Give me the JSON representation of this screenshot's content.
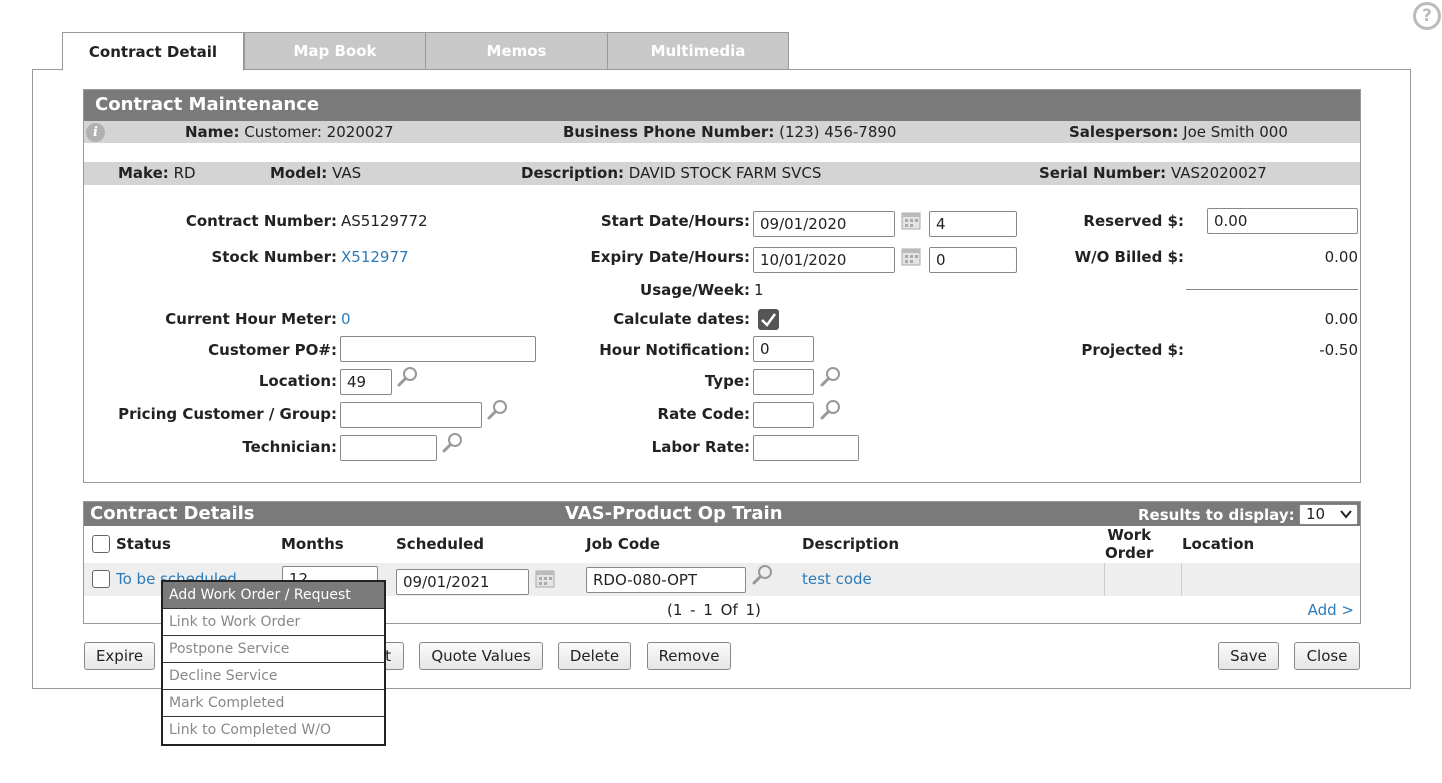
{
  "tabs": [
    "Contract Detail",
    "Map Book",
    "Memos",
    "Multimedia"
  ],
  "maintenance": {
    "title": "Contract Maintenance",
    "name_label": "Name:",
    "name_value": "Customer: 2020027",
    "phone_label": "Business Phone Number:",
    "phone_value": "(123) 456-7890",
    "sales_label": "Salesperson:",
    "sales_value": "Joe Smith 000",
    "make_label": "Make:",
    "make_value": "RD",
    "model_label": "Model:",
    "model_value": "VAS",
    "desc_label": "Description:",
    "desc_value": "DAVID STOCK FARM SVCS",
    "serial_label": "Serial Number:",
    "serial_value": "VAS2020027"
  },
  "form": {
    "contract_number_label": "Contract Number:",
    "contract_number": "AS5129772",
    "stock_number_label": "Stock Number:",
    "stock_number": "X512977",
    "hour_meter_label": "Current Hour Meter:",
    "hour_meter": "0",
    "customer_po_label": "Customer PO#:",
    "customer_po": "",
    "location_label": "Location:",
    "location": "49",
    "pricing_label": "Pricing Customer / Group:",
    "pricing": "",
    "technician_label": "Technician:",
    "technician": "",
    "start_label": "Start Date/Hours:",
    "start_date": "09/01/2020",
    "start_hours": "4",
    "expiry_label": "Expiry Date/Hours:",
    "expiry_date": "10/01/2020",
    "expiry_hours": "0",
    "usage_label": "Usage/Week:",
    "usage": "1",
    "calc_label": "Calculate dates:",
    "hour_notif_label": "Hour Notification:",
    "hour_notif": "0",
    "type_label": "Type:",
    "type": "",
    "rate_code_label": "Rate Code:",
    "rate_code": "",
    "labor_rate_label": "Labor Rate:",
    "labor_rate": "",
    "reserved_label": "Reserved $:",
    "reserved": "0.00",
    "wo_billed_label": "W/O Billed $:",
    "wo_billed": "0.00",
    "subtotal": "0.00",
    "projected_label": "Projected $:",
    "projected": "-0.50"
  },
  "details": {
    "title": "Contract Details",
    "center_title": "VAS-Product Op Train",
    "results_label": "Results to display:",
    "results_value": "10",
    "columns": {
      "status": "Status",
      "months": "Months",
      "scheduled": "Scheduled",
      "job_code": "Job Code",
      "description": "Description",
      "work_order_1": "Work",
      "work_order_2": "Order",
      "location": "Location"
    },
    "row": {
      "status": "To be scheduled",
      "months": "12",
      "scheduled": "09/01/2021",
      "job_code": "RDO-080-OPT",
      "description": "test code"
    },
    "pagination": "(1 - 1 Of 1)",
    "add": "Add >"
  },
  "buttons": {
    "expire": "Expire",
    "hidden": "t",
    "quote": "Quote Values",
    "delete": "Delete",
    "remove": "Remove",
    "save": "Save",
    "close": "Close"
  },
  "menu": [
    "Add Work Order / Request",
    "Link to Work Order",
    "Postpone Service",
    "Decline Service",
    "Mark Completed",
    "Link to Completed W/O"
  ]
}
